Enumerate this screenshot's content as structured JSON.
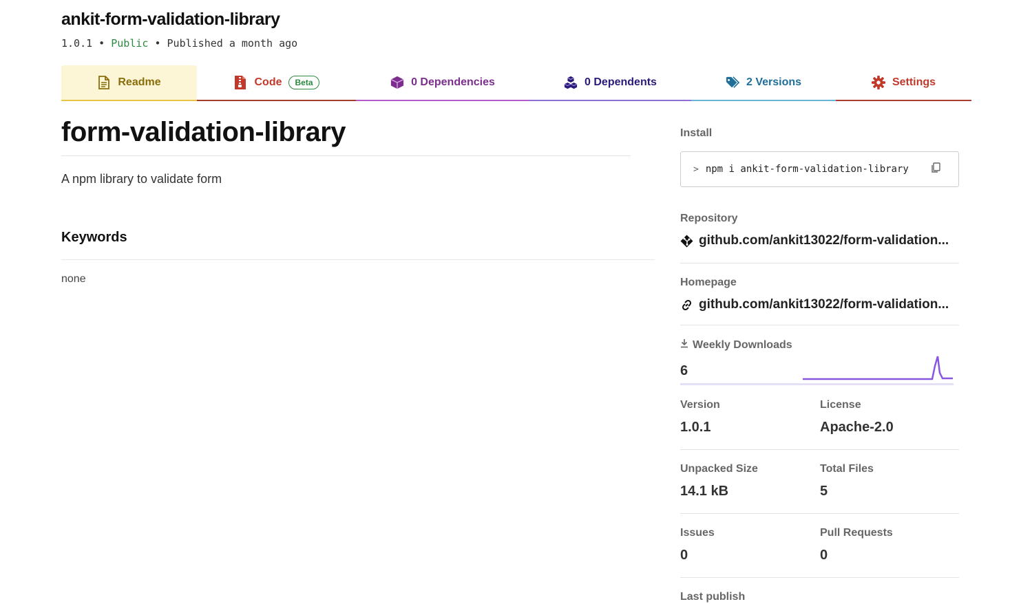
{
  "package": {
    "title": "ankit-form-validation-library",
    "version": "1.0.1",
    "separator": " • ",
    "visibility": "Public",
    "published": "Published a month ago"
  },
  "tabs": [
    {
      "label": "Readme",
      "icon": "readme-file-icon"
    },
    {
      "label": "Code",
      "icon": "code-zip-icon",
      "badge": "Beta"
    },
    {
      "label": "0 Dependencies",
      "icon": "box-icon"
    },
    {
      "label": "0 Dependents",
      "icon": "boxes-icon"
    },
    {
      "label": "2 Versions",
      "icon": "tags-icon"
    },
    {
      "label": "Settings",
      "icon": "gear-icon"
    }
  ],
  "readme": {
    "title": "form-validation-library",
    "description": "A npm library to validate form",
    "keywords_title": "Keywords",
    "keywords_value": "none"
  },
  "sidebar": {
    "install_label": "Install",
    "install_command": "npm i ankit-form-validation-library",
    "repository_label": "Repository",
    "repository_value": "github.com/ankit13022/form-validation...",
    "homepage_label": "Homepage",
    "homepage_value": "github.com/ankit13022/form-validation...",
    "weekly_downloads_label": "Weekly Downloads",
    "weekly_downloads_value": "6",
    "version_label": "Version",
    "version_value": "1.0.1",
    "license_label": "License",
    "license_value": "Apache-2.0",
    "unpacked_size_label": "Unpacked Size",
    "unpacked_size_value": "14.1 kB",
    "total_files_label": "Total Files",
    "total_files_value": "5",
    "issues_label": "Issues",
    "issues_value": "0",
    "pull_requests_label": "Pull Requests",
    "pull_requests_value": "0",
    "last_publish_label": "Last publish"
  },
  "colors": {
    "readme": "#8a6d0b",
    "code": "#c0392b",
    "dependencies": "#7b2e8e",
    "dependents": "#2c1a7a",
    "versions": "#1f6f9a",
    "settings": "#c0392b",
    "public": "#2b8a3e",
    "sparkline": "#8956e0"
  }
}
